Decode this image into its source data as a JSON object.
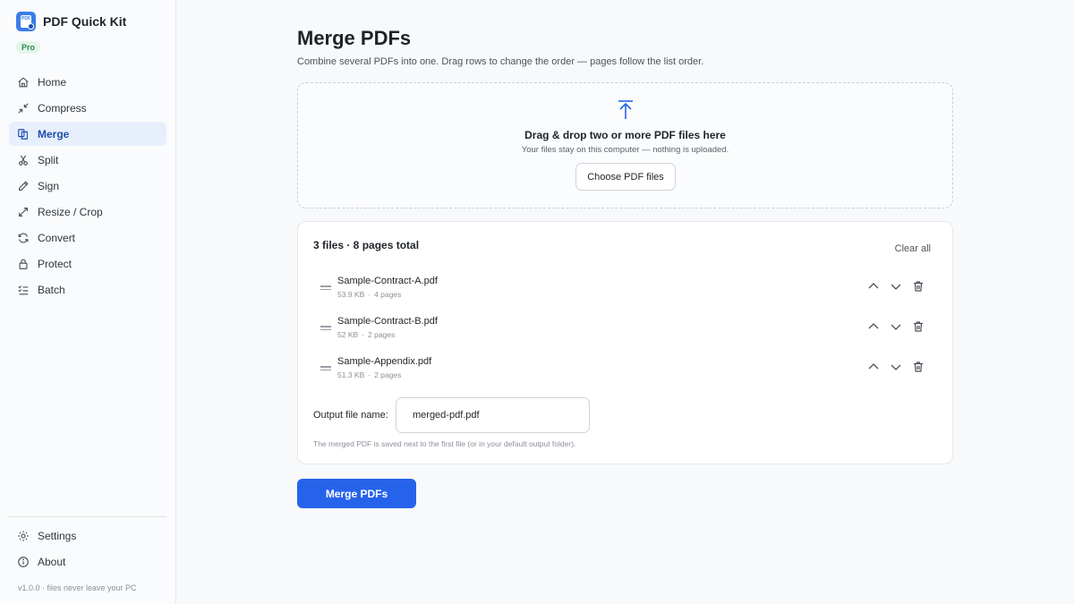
{
  "app": {
    "name": "PDF Quick Kit",
    "logo_text": "PDF",
    "badge": "Pro",
    "version_note": "v1.0.0 · files never leave your PC"
  },
  "sidebar": {
    "items": [
      {
        "label": "Home",
        "icon": "home-icon",
        "active": false
      },
      {
        "label": "Compress",
        "icon": "compress-icon",
        "active": false
      },
      {
        "label": "Merge",
        "icon": "merge-icon",
        "active": true
      },
      {
        "label": "Split",
        "icon": "scissors-icon",
        "active": false
      },
      {
        "label": "Sign",
        "icon": "pen-icon",
        "active": false
      },
      {
        "label": "Resize / Crop",
        "icon": "resize-icon",
        "active": false
      },
      {
        "label": "Convert",
        "icon": "convert-icon",
        "active": false
      },
      {
        "label": "Protect",
        "icon": "lock-icon",
        "active": false
      },
      {
        "label": "Batch",
        "icon": "list-check-icon",
        "active": false
      }
    ],
    "bottom_items": [
      {
        "label": "Settings",
        "icon": "gear-icon"
      },
      {
        "label": "About",
        "icon": "info-icon"
      }
    ]
  },
  "main": {
    "title": "Merge PDFs",
    "subtitle": "Combine several PDFs into one. Drag rows to change the order — pages follow the list order.",
    "dropzone": {
      "icon": "upload-icon",
      "title": "Drag & drop two or more PDF files here",
      "subtitle": "Your files stay on this computer — nothing is uploaded.",
      "button_label": "Choose PDF files"
    },
    "files_card": {
      "summary": "3 files · 8 pages total",
      "clear_all_label": "Clear all",
      "files": [
        {
          "name": "Sample-Contract-A.pdf",
          "size": "53.9 KB",
          "pages": "4 pages"
        },
        {
          "name": "Sample-Contract-B.pdf",
          "size": "52 KB",
          "pages": "2 pages"
        },
        {
          "name": "Sample-Appendix.pdf",
          "size": "51.3 KB",
          "pages": "2 pages"
        }
      ],
      "output_label": "Output file name:",
      "output_value": "merged-pdf.pdf",
      "output_note": "The merged PDF is saved next to the first file (or in your default output folder)."
    },
    "merge_button_label": "Merge PDFs"
  },
  "colors": {
    "accent": "#2563eb",
    "active_nav_bg": "#e8effc",
    "badge_green": "#2f8a4e"
  }
}
